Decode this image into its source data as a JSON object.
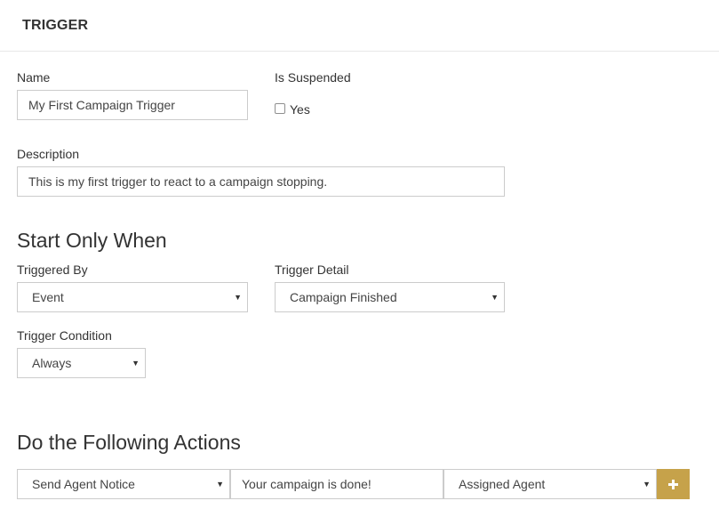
{
  "section_title": "TRIGGER",
  "form": {
    "name_label": "Name",
    "name_value": "My First Campaign Trigger",
    "suspended_label": "Is Suspended",
    "suspended_option": "Yes",
    "suspended_checked": false,
    "description_label": "Description",
    "description_value": "This is my first trigger to react to a campaign stopping."
  },
  "start_section": {
    "heading": "Start Only When",
    "triggered_by_label": "Triggered By",
    "triggered_by_value": "Event",
    "trigger_detail_label": "Trigger Detail",
    "trigger_detail_value": "Campaign Finished",
    "trigger_condition_label": "Trigger Condition",
    "trigger_condition_value": "Always"
  },
  "actions_section": {
    "heading": "Do the Following Actions",
    "action_type_value": "Send Agent Notice",
    "message_value": "Your campaign is done!",
    "recipient_value": "Assigned Agent"
  },
  "icons": {
    "dropdown": "chevron-down-icon",
    "add": "plus-icon"
  },
  "colors": {
    "accent": "#c6a24a",
    "border": "#cccccc",
    "text": "#333333"
  }
}
